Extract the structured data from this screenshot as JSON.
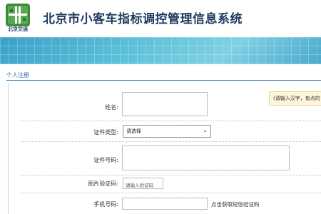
{
  "header": {
    "logo_text": "北京交通",
    "title": "北京市小客车指标调控管理信息系统"
  },
  "section": {
    "title": "个人注册"
  },
  "form": {
    "name_label": "姓名:",
    "name_hint": "(请输入汉字，有点的",
    "id_type_label": "证件类型:",
    "id_type_selected": "请选择",
    "id_number_label": "证件号码:",
    "captcha_label": "图片验证码:",
    "captcha_placeholder": "请输入验证码",
    "phone_label": "手机号码:",
    "sms_link": "点击获取短信验证码"
  },
  "colors": {
    "title": "#1f3b5f",
    "accent": "#2d6aa8",
    "banner": "#5bc0d8",
    "hint_bg": "#fdf6dc"
  },
  "icons": {
    "logo": "beijing-transport-logo-icon",
    "select_arrow": "chevron-down-icon"
  }
}
